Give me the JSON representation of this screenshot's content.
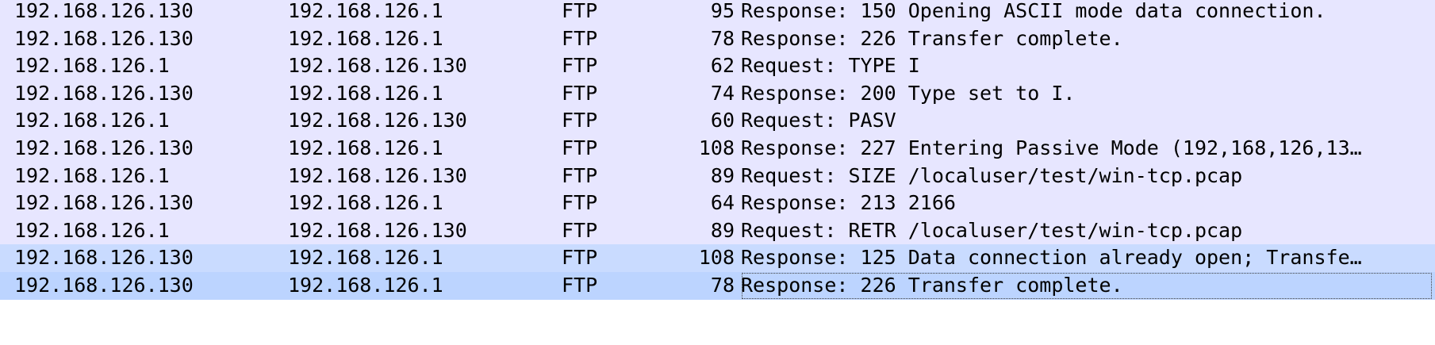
{
  "colors": {
    "row_bg": "#e7e6ff",
    "row_highlight": "#c9dbff",
    "row_selected": "#bcd4ff"
  },
  "packets": [
    {
      "source": "192.168.126.130",
      "destination": "192.168.126.1",
      "protocol": "FTP",
      "length": "95",
      "info": "Response: 150 Opening ASCII mode data connection."
    },
    {
      "source": "192.168.126.130",
      "destination": "192.168.126.1",
      "protocol": "FTP",
      "length": "78",
      "info": "Response: 226 Transfer complete."
    },
    {
      "source": "192.168.126.1",
      "destination": "192.168.126.130",
      "protocol": "FTP",
      "length": "62",
      "info": "Request: TYPE I"
    },
    {
      "source": "192.168.126.130",
      "destination": "192.168.126.1",
      "protocol": "FTP",
      "length": "74",
      "info": "Response: 200 Type set to I."
    },
    {
      "source": "192.168.126.1",
      "destination": "192.168.126.130",
      "protocol": "FTP",
      "length": "60",
      "info": "Request: PASV"
    },
    {
      "source": "192.168.126.130",
      "destination": "192.168.126.1",
      "protocol": "FTP",
      "length": "108",
      "info": "Response: 227 Entering Passive Mode (192,168,126,13…"
    },
    {
      "source": "192.168.126.1",
      "destination": "192.168.126.130",
      "protocol": "FTP",
      "length": "89",
      "info": "Request: SIZE /localuser/test/win-tcp.pcap"
    },
    {
      "source": "192.168.126.130",
      "destination": "192.168.126.1",
      "protocol": "FTP",
      "length": "64",
      "info": "Response: 213 2166"
    },
    {
      "source": "192.168.126.1",
      "destination": "192.168.126.130",
      "protocol": "FTP",
      "length": "89",
      "info": "Request: RETR /localuser/test/win-tcp.pcap"
    },
    {
      "source": "192.168.126.130",
      "destination": "192.168.126.1",
      "protocol": "FTP",
      "length": "108",
      "info": "Response: 125 Data connection already open; Transfe…",
      "state": "highlight"
    },
    {
      "source": "192.168.126.130",
      "destination": "192.168.126.1",
      "protocol": "FTP",
      "length": "78",
      "info": "Response: 226 Transfer complete.",
      "state": "selected"
    }
  ]
}
